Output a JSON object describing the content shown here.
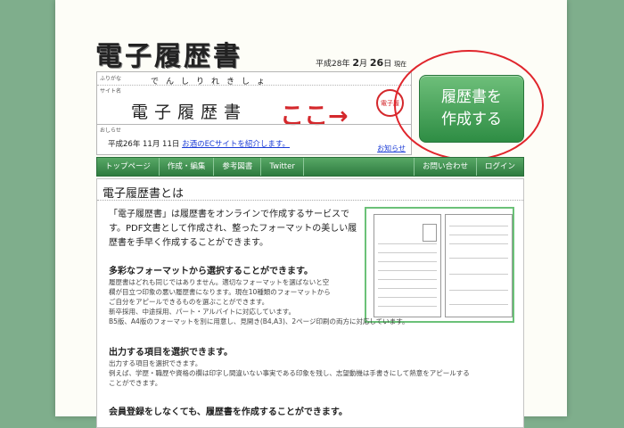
{
  "header": {
    "logo_text": "電子履歴書",
    "date_era": "平成",
    "date_year": "28",
    "date_year_unit": "年",
    "date_month": "2",
    "date_month_unit": "月",
    "date_day": "26",
    "date_day_unit": "日",
    "date_suffix": "現在"
  },
  "form": {
    "furigana_label": "ふりがな",
    "furigana_value": "でんしりれきしょ",
    "site_name_label": "サイト名",
    "site_name_value": "電子履歴書",
    "annotation": "ここ→",
    "seal_text": "電子履",
    "notice_label": "おしらせ",
    "notice_date": "平成26年 11月 11日",
    "notice_link": "お酒のECサイトを紹介します。",
    "notice_more": "お知らせ"
  },
  "cta": {
    "line1": "履歴書を",
    "line2": "作成する"
  },
  "nav": {
    "left": [
      "トップページ",
      "作成・編集",
      "参考図書",
      "Twitter"
    ],
    "right": [
      "お問い合わせ",
      "ログイン"
    ]
  },
  "content": {
    "section_title": "電子履歴書とは",
    "intro": "「電子履歴書」は履歴書をオンラインで作成するサービスです。PDF文書として作成され、整ったフォーマットの美しい履歴書を手早く作成することができます。",
    "h1": "多彩なフォーマットから選択することができます。",
    "p1_l1": "履歴書はどれも同じではありません。適切なフォーマットを選ばないと空",
    "p1_l2": "欄が目立つ印象の悪い履歴書になります。現在10種類のフォーマットから",
    "p1_l3": "ご自分をアピールできるものを選ぶことができます。",
    "p1_l4": "新卒採用、中途採用、パート・アルバイトに対応しています。",
    "p1_l5": "B5版、A4版のフォーマットを別に用意し、見開き(B4,A3)、2ページ印刷の両方に対応しています。",
    "h2": "出力する項目を選択できます。",
    "p2_l1": "出力する項目を選択できます。",
    "p2_l2": "例えば、学歴・職歴や資格の欄は印字し間違いない事実である印象を残し、志望動機は手書きにして熱意をアピールする",
    "p2_l3": "ことができます。",
    "h3": "会員登録をしなくても、履歴書を作成することができます。"
  },
  "colors": {
    "background": "#7fae8c",
    "nav_green": "#3e8f50",
    "cta_green": "#2e8d44",
    "annotation_red": "#d4282c",
    "link_blue": "#1a3bd6"
  }
}
